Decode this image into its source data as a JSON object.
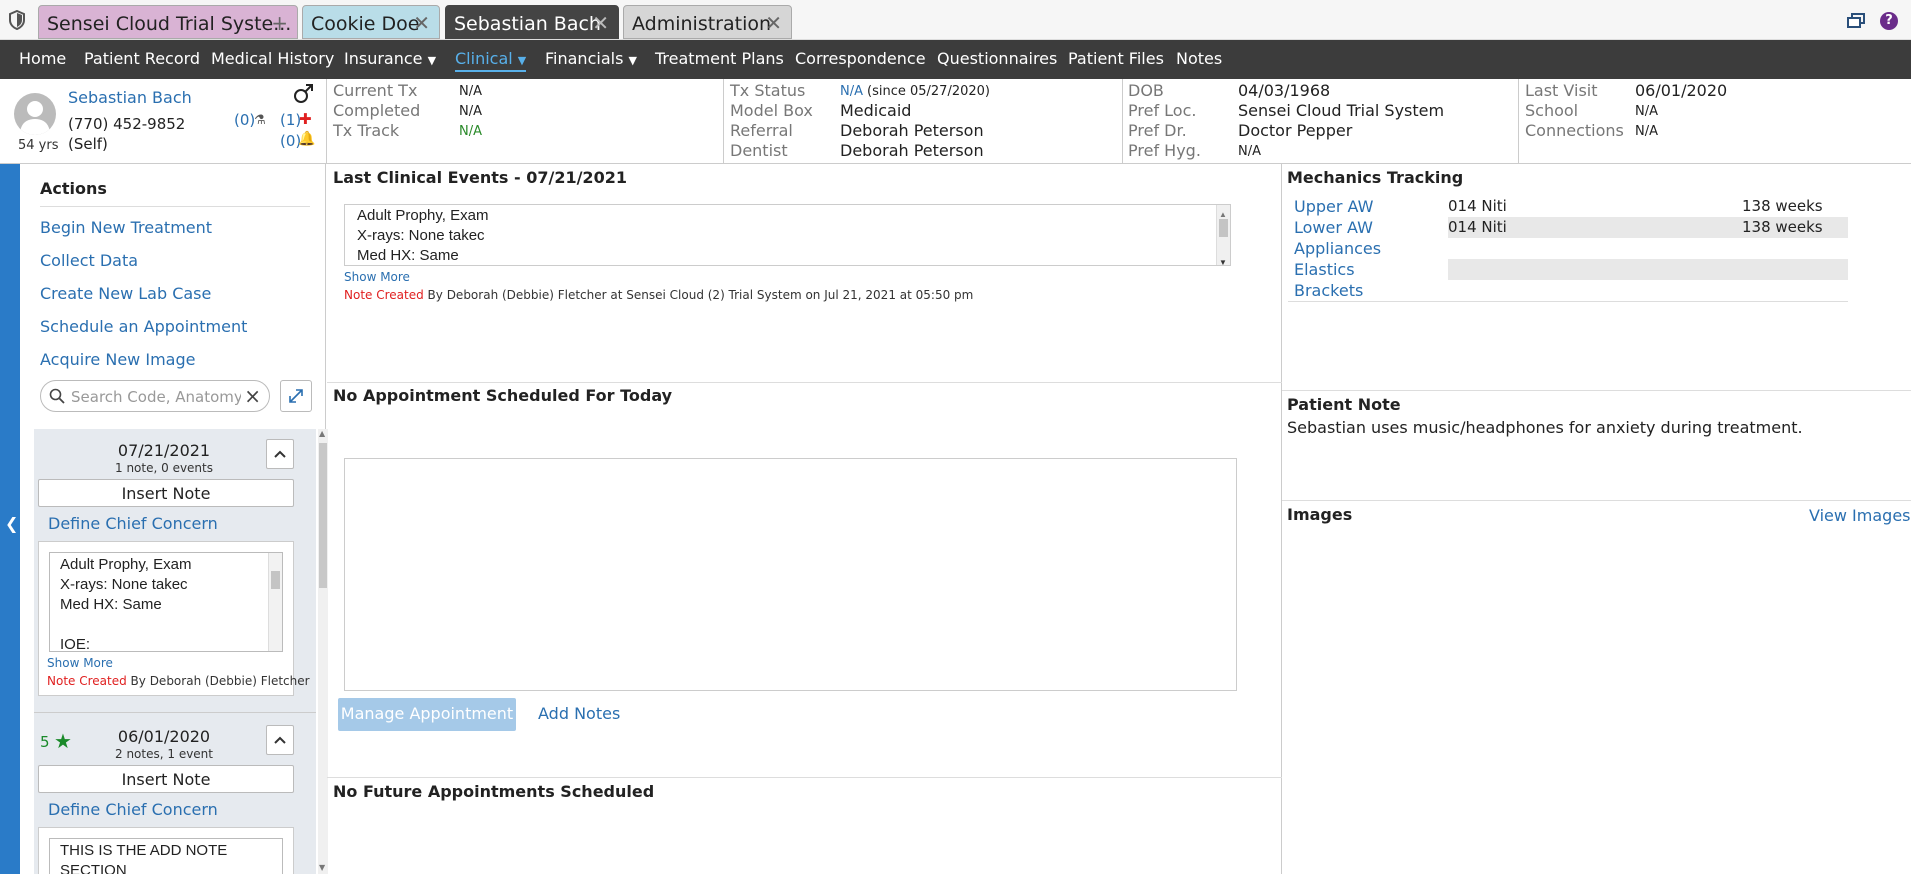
{
  "tabs": [
    {
      "label": "Sensei Cloud Trial Syste...",
      "action": "+"
    },
    {
      "label": "Cookie Doe",
      "action": "✕"
    },
    {
      "label": "Sebastian Bach",
      "action": "✕"
    },
    {
      "label": "Administration",
      "action": "✕"
    }
  ],
  "nav": {
    "items": [
      "Home",
      "Patient Record",
      "Medical History",
      "Insurance",
      "Clinical",
      "Financials",
      "Treatment Plans",
      "Correspondence",
      "Questionnaires",
      "Patient Files",
      "Notes"
    ],
    "active": "Clinical"
  },
  "patient": {
    "name": "Sebastian Bach",
    "phone": "(770) 452-9852",
    "relation": "(Self)",
    "age": "54 yrs",
    "count_lab": "(0)",
    "count_med": "(1)",
    "count_alert": "(0)"
  },
  "header": {
    "col1": [
      {
        "label": "Current Tx",
        "value": "N/A"
      },
      {
        "label": "Completed",
        "value": "N/A"
      },
      {
        "label": "Tx Track",
        "value": "N/A"
      }
    ],
    "col2": [
      {
        "label": "Tx Status",
        "value": "N/A",
        "extra": "(since 05/27/2020)"
      },
      {
        "label": "Model Box",
        "value": "Medicaid"
      },
      {
        "label": "Referral",
        "value": "Deborah Peterson"
      },
      {
        "label": "Dentist",
        "value": "Deborah Peterson"
      }
    ],
    "col3": [
      {
        "label": "DOB",
        "value": "04/03/1968"
      },
      {
        "label": "Pref Loc.",
        "value": "Sensei Cloud Trial System"
      },
      {
        "label": "Pref Dr.",
        "value": "Doctor Pepper"
      },
      {
        "label": "Pref Hyg.",
        "value": "N/A"
      }
    ],
    "col4": [
      {
        "label": "Last Visit",
        "value": "06/01/2020"
      },
      {
        "label": "School",
        "value": "N/A"
      },
      {
        "label": "Connections",
        "value": "N/A"
      }
    ]
  },
  "actions": {
    "title": "Actions",
    "items": [
      "Begin New Treatment",
      "Collect Data",
      "Create New Lab Case",
      "Schedule an Appointment",
      "Acquire New Image"
    ]
  },
  "search": {
    "placeholder": "Search Code, Anatomy, Notes"
  },
  "timeline": [
    {
      "date": "07/21/2021",
      "summary": "1 note,  0 events",
      "insert_label": "Insert Note",
      "concern_label": "Define Chief Concern",
      "note_lines": [
        "Adult Prophy, Exam",
        "X-rays: None takec",
        "Med HX: Same",
        "",
        "IOE:"
      ],
      "show_more": "Show More",
      "created_prefix": "Note Created",
      "created_by": "By Deborah (Debbie) Fletcher"
    },
    {
      "date": "06/01/2020",
      "summary": "2 notes,  1 event",
      "rating": "5",
      "insert_label": "Insert Note",
      "concern_label": "Define Chief Concern",
      "note_lines": [
        "THIS IS THE ADD NOTE",
        "SECTION"
      ]
    }
  ],
  "last_clinical": {
    "title": "Last Clinical Events - 07/21/2021",
    "lines": [
      "Adult Prophy, Exam",
      "X-rays: None takec",
      "Med HX: Same"
    ],
    "show_more": "Show More",
    "created_prefix": "Note Created",
    "created_text": "By Deborah (Debbie) Fletcher at Sensei Cloud (2) Trial System on Jul 21, 2021 at 05:50 pm"
  },
  "appointment": {
    "title": "No Appointment Scheduled For Today",
    "manage_label": "Manage Appointment",
    "add_notes_label": "Add Notes"
  },
  "future": {
    "title": "No Future Appointments Scheduled"
  },
  "mechanics": {
    "title": "Mechanics Tracking",
    "rows": [
      {
        "label": "Upper AW",
        "wire": "014 Niti",
        "duration": "138 weeks"
      },
      {
        "label": "Lower AW",
        "wire": "014 Niti",
        "duration": "138 weeks"
      },
      {
        "label": "Appliances",
        "wire": "",
        "duration": ""
      },
      {
        "label": "Elastics",
        "wire": "",
        "duration": ""
      },
      {
        "label": "Brackets",
        "wire": "",
        "duration": ""
      }
    ]
  },
  "patient_note": {
    "title": "Patient Note",
    "text": "Sebastian uses music/headphones for anxiety during treatment."
  },
  "images": {
    "title": "Images",
    "view_label": "View Images"
  }
}
